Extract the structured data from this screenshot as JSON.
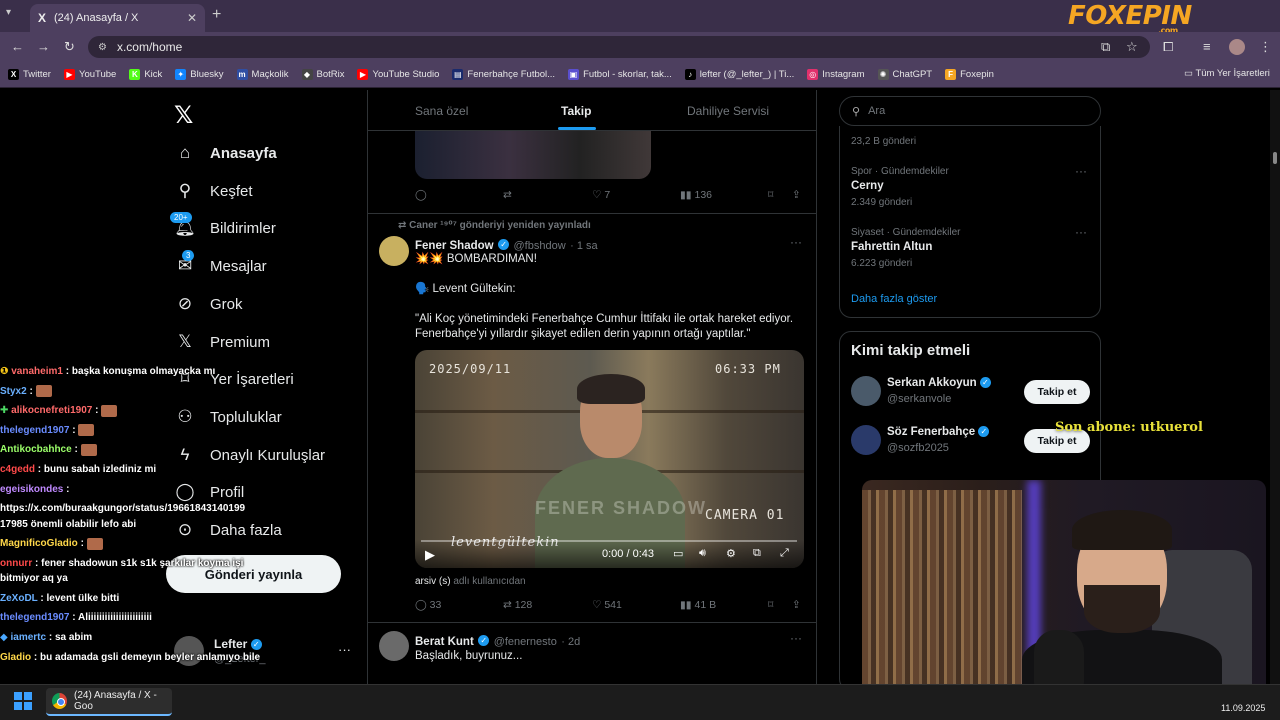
{
  "browser": {
    "tab_title": "(24) Anasayfa / X",
    "url": "x.com/home",
    "bookmarks": [
      {
        "label": "Twitter",
        "color": "#000000",
        "glyph": "X"
      },
      {
        "label": "YouTube",
        "color": "#ff0000",
        "glyph": "▶"
      },
      {
        "label": "Kick",
        "color": "#53fc18",
        "glyph": "K"
      },
      {
        "label": "Bluesky",
        "color": "#1185fe",
        "glyph": "✦"
      },
      {
        "label": "Maçkolik",
        "color": "#2f4ea3",
        "glyph": "m"
      },
      {
        "label": "BotRix",
        "color": "#444444",
        "glyph": "◆"
      },
      {
        "label": "YouTube Studio",
        "color": "#ff0000",
        "glyph": "▶"
      },
      {
        "label": "Fenerbahçe Futbol...",
        "color": "#1a2b6d",
        "glyph": "▤"
      },
      {
        "label": "Futbol - skorlar, tak...",
        "color": "#5a4fcf",
        "glyph": "▣"
      },
      {
        "label": "lefter (@_lefter_) | Ti...",
        "color": "#000000",
        "glyph": "♪"
      },
      {
        "label": "Instagram",
        "color": "#e1306c",
        "glyph": "◎"
      },
      {
        "label": "ChatGPT",
        "color": "#555555",
        "glyph": "✺"
      },
      {
        "label": "Foxepin",
        "color": "#f5a623",
        "glyph": "F"
      }
    ],
    "all_bookmarks": "Tüm Yer İşaretleri"
  },
  "watermark": {
    "text": "FOXEPIN",
    "sub": ".com"
  },
  "nav": {
    "items": [
      {
        "label": "Anasayfa",
        "icon": "home-icon"
      },
      {
        "label": "Keşfet",
        "icon": "search-icon"
      },
      {
        "label": "Bildirimler",
        "icon": "bell-icon",
        "badge": "20+"
      },
      {
        "label": "Mesajlar",
        "icon": "mail-icon",
        "badge": "3"
      },
      {
        "label": "Grok",
        "icon": "grok-icon"
      },
      {
        "label": "Premium",
        "icon": "x-premium-icon"
      },
      {
        "label": "Yer İşaretleri",
        "icon": "bookmark-icon"
      },
      {
        "label": "Topluluklar",
        "icon": "communities-icon"
      },
      {
        "label": "Onaylı Kuruluşlar",
        "icon": "lightning-icon"
      },
      {
        "label": "Profil",
        "icon": "profile-icon"
      },
      {
        "label": "Daha fazla",
        "icon": "more-circle-icon"
      }
    ],
    "post_button": "Gönderi yayınla",
    "profile": {
      "name": "Lefter",
      "handle": "@_Lefter_"
    }
  },
  "chat": [
    {
      "user": "vanaheim1",
      "color": "#ff6a6a",
      "msg": ": başka konuşma olmayacka mı"
    },
    {
      "user": "Styx2",
      "color": "#6ab0ff",
      "msg": ":"
    },
    {
      "user": "alikocnefreti1907",
      "color": "#ff6a6a",
      "msg": ":"
    },
    {
      "user": "thelegend1907",
      "color": "#6a8cff",
      "msg": ":"
    },
    {
      "user": "Antikocbahhce",
      "color": "#9cff6a",
      "msg": ":"
    },
    {
      "user": "c4gedd",
      "color": "#ff4a4a",
      "msg": ": bunu sabah izlediniz mi"
    },
    {
      "user": "egeisikondes",
      "color": "#c08aff",
      "msg": ":"
    },
    {
      "user": "",
      "color": "#ffffff",
      "msg": "https://x.com/buraakgungor/status/19661843140199 17985 önemli olabilir lefo abi"
    },
    {
      "user": "MagnificoGladio",
      "color": "#ffd84a",
      "msg": ":"
    },
    {
      "user": "onnurr",
      "color": "#ff4a4a",
      "msg": ": fener shadowun s1k s1k şarkılar koyma işi bitmiyor aq ya"
    },
    {
      "user": "ZeXoDL",
      "color": "#6ab0ff",
      "msg": ": levent ülke bitti"
    },
    {
      "user": "thelegend1907",
      "color": "#6a8cff",
      "msg": ": Aliiiiiiiiiiiiiiiiiiiiiii"
    },
    {
      "user": "iamertc",
      "color": "#6ab0ff",
      "msg": ": sa abim"
    },
    {
      "user": "Gladio",
      "color": "#ffd84a",
      "msg": ": bu adamada gsli demeyın beyler anlamıyo bile"
    }
  ],
  "feed": {
    "tabs": [
      "Sana özel",
      "Takip",
      "Dahiliye Servisi"
    ],
    "top_actions": {
      "likes": "7",
      "views": "136"
    },
    "tweet": {
      "repost_note": "Caner ¹⁹⁰⁷ gönderiyi yeniden yayınladı",
      "name": "Fener Shadow",
      "handle": "@fbshdow",
      "time": "· 1 sa",
      "line1": "💥💥 BOMBARDIMAN!",
      "line2": "🗣️ Levent Gültekin:",
      "line3": "\"Ali Koç yönetimindeki Fenerbahçe Cumhur İttifakı ile ortak hareket ediyor. Fenerbahçe'yi yıllardır şikayet edilen derin yapının ortağı yaptılar.\"",
      "video_date": "2025/09/11",
      "video_clock": "06:33 PM",
      "video_cam": "CAMERA 01",
      "video_watermark": "FENER SHADOW",
      "video_name": "leventgültekin",
      "video_time": "0:00 / 0:43",
      "source_user": "arsiv (s)",
      "source_suffix": "adlı kullanıcıdan",
      "replies": "33",
      "reposts": "128",
      "likes": "541",
      "views": "41 B"
    },
    "tweet2": {
      "name": "Berat Kunt",
      "handle": "@fenernesto",
      "time": "· 2d",
      "text": "Başladık, buyrunuz..."
    }
  },
  "right": {
    "search_placeholder": "Ara",
    "trend0_count": "23,2 B gönderi",
    "trends": [
      {
        "sub": "Spor · Gündemdekiler",
        "name": "Cerny",
        "count": "2.349 gönderi"
      },
      {
        "sub": "Siyaset · Gündemdekiler",
        "name": "Fahrettin Altun",
        "count": "6.223 gönderi"
      }
    ],
    "show_more": "Daha fazla göster",
    "who_title": "Kimi takip etmeli",
    "suggestions": [
      {
        "name": "Serkan Akkoyun",
        "handle": "@serkanvole",
        "button": "Takip et"
      },
      {
        "name": "Söz Fenerbahçe",
        "handle": "@sozfb2025",
        "button": "Takip et"
      }
    ]
  },
  "sub_note": "Son abone: utkuerol",
  "taskbar": {
    "item": "(24) Anasayfa / X - Goo",
    "date": "11.09.2025"
  }
}
